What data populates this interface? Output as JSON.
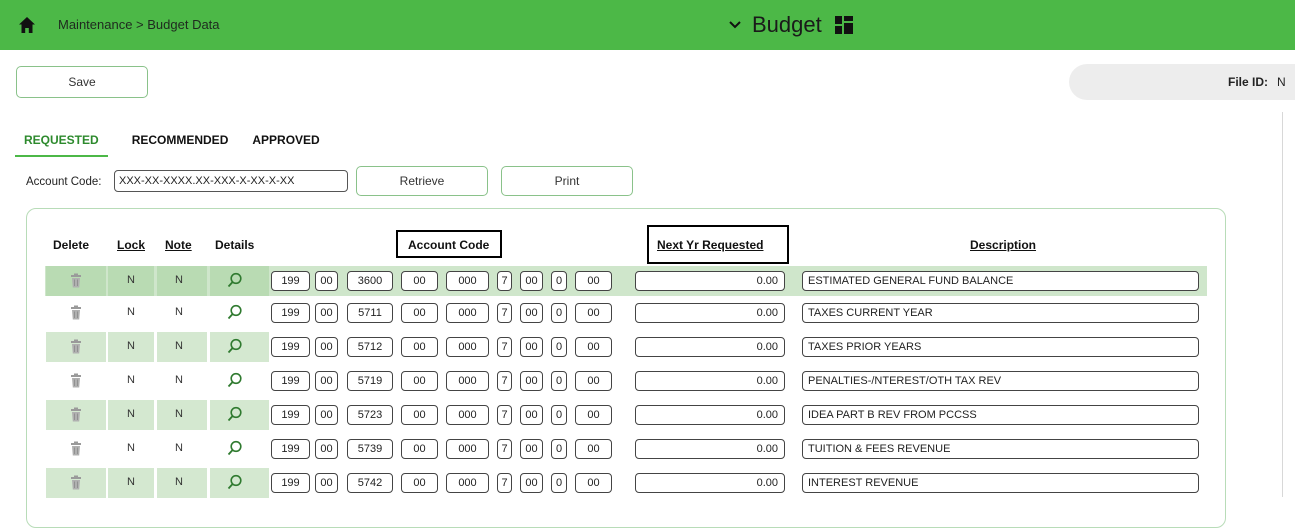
{
  "header": {
    "breadcrumb": "Maintenance > Budget Data",
    "title": "Budget",
    "bar_color": "#4cb847",
    "icons": [
      "home-icon",
      "chevron-down-icon",
      "grid-icon"
    ]
  },
  "toolbar": {
    "save_label": "Save",
    "file_id_label": "File ID:",
    "file_id_value": "N"
  },
  "tabs": [
    {
      "label": "REQUESTED",
      "active": true
    },
    {
      "label": "RECOMMENDED",
      "active": false
    },
    {
      "label": "APPROVED",
      "active": false
    }
  ],
  "account": {
    "label": "Account Code:",
    "value": "XXX-XX-XXXX.XX-XXX-X-XX-X-XX",
    "retrieve_label": "Retrieve",
    "print_label": "Print"
  },
  "table": {
    "headers": {
      "delete": "Delete",
      "lock": "Lock",
      "note": "Note",
      "details": "Details",
      "account_code": "Account Code",
      "next_yr": "Next Yr Requested",
      "description": "Description"
    },
    "rows": [
      {
        "lock": "N",
        "note": "N",
        "segments": [
          "199",
          "00",
          "3600",
          "00",
          "000",
          "7",
          "00",
          "0",
          "00"
        ],
        "amount": "0.00",
        "description": "ESTIMATED GENERAL FUND BALANCE"
      },
      {
        "lock": "N",
        "note": "N",
        "segments": [
          "199",
          "00",
          "5711",
          "00",
          "000",
          "7",
          "00",
          "0",
          "00"
        ],
        "amount": "0.00",
        "description": "TAXES CURRENT YEAR"
      },
      {
        "lock": "N",
        "note": "N",
        "segments": [
          "199",
          "00",
          "5712",
          "00",
          "000",
          "7",
          "00",
          "0",
          "00"
        ],
        "amount": "0.00",
        "description": "TAXES PRIOR YEARS"
      },
      {
        "lock": "N",
        "note": "N",
        "segments": [
          "199",
          "00",
          "5719",
          "00",
          "000",
          "7",
          "00",
          "0",
          "00"
        ],
        "amount": "0.00",
        "description": "PENALTIES-/NTEREST/OTH TAX REV"
      },
      {
        "lock": "N",
        "note": "N",
        "segments": [
          "199",
          "00",
          "5723",
          "00",
          "000",
          "7",
          "00",
          "0",
          "00"
        ],
        "amount": "0.00",
        "description": "IDEA PART B REV FROM PCCSS"
      },
      {
        "lock": "N",
        "note": "N",
        "segments": [
          "199",
          "00",
          "5739",
          "00",
          "000",
          "7",
          "00",
          "0",
          "00"
        ],
        "amount": "0.00",
        "description": "TUITION & FEES REVENUE"
      },
      {
        "lock": "N",
        "note": "N",
        "segments": [
          "199",
          "00",
          "5742",
          "00",
          "000",
          "7",
          "00",
          "0",
          "00"
        ],
        "amount": "0.00",
        "description": "INTEREST REVENUE"
      }
    ]
  }
}
